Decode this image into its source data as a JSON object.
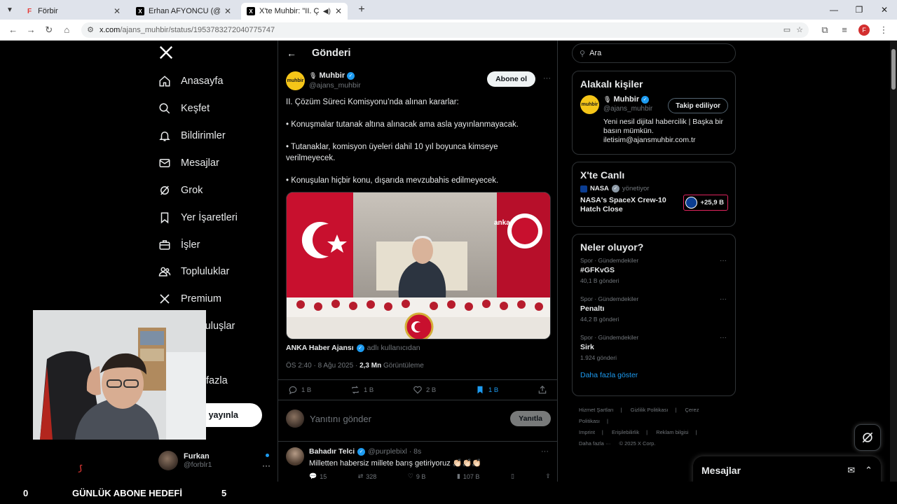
{
  "browser": {
    "tabs": [
      {
        "title": "Förbir",
        "favicon": "red-f-icon",
        "active": false
      },
      {
        "title": "Erhan AFYONCU (@eafyoncu) /",
        "favicon": "x-icon",
        "active": false
      },
      {
        "title": "X'te   Muhbir: \"II. Çözüm",
        "favicon": "x-icon",
        "active": true
      }
    ],
    "url_host": "x.com",
    "url_path": "/ajans_muhbir/status/1953783272040775747"
  },
  "nav": {
    "items": [
      {
        "label": "Anasayfa",
        "icon": "home-icon"
      },
      {
        "label": "Keşfet",
        "icon": "search-icon"
      },
      {
        "label": "Bildirimler",
        "icon": "bell-icon"
      },
      {
        "label": "Mesajlar",
        "icon": "mail-icon"
      },
      {
        "label": "Grok",
        "icon": "grok-icon"
      },
      {
        "label": "Yer İşaretleri",
        "icon": "bookmark-icon"
      },
      {
        "label": "İşler",
        "icon": "briefcase-icon"
      },
      {
        "label": "Topluluklar",
        "icon": "people-icon"
      },
      {
        "label": "Premium",
        "icon": "x-icon"
      },
      {
        "label": "n Kuruluşlar",
        "icon": "lightning-icon"
      },
      {
        "label": "",
        "icon": "person-icon"
      },
      {
        "label": "fazla",
        "icon": "more-icon"
      }
    ],
    "post_label": "i yayınla",
    "account": {
      "name": "Furkan",
      "handle": "@forblr1"
    }
  },
  "post": {
    "header_title": "Gönderi",
    "author_name": "Muhbir",
    "author_handle": "@ajans_muhbir",
    "avatar_text": "muhbir",
    "subscribe_label": "Abone ol",
    "text_lines": [
      "II. Çözüm Süreci Komisyonu’nda alınan kararlar:",
      "• Konuşmalar tutanak altına alınacak ama asla yayınlanmayacak.",
      "• Tutanaklar, komisyon üyeleri dahil 10 yıl boyunca kimseye verilmeyecek.",
      "• Konuşulan hiçbir konu, dışarıda mevzubahis edilmeyecek."
    ],
    "media_watermark": "anka",
    "media_source_name": "ANKA Haber Ajansı",
    "media_source_suffix": "adlı kullanıcıdan",
    "time": "ÖS 2:40 · 8 Ağu 2025 · ",
    "views_count": "2,3 Mn",
    "views_label": "Görüntüleme",
    "replies": "1 B",
    "reposts": "1 B",
    "likes": "2 B",
    "bookmarks": "1 B"
  },
  "reply_box": {
    "placeholder": "Yanıtını gönder",
    "button": "Yanıtla"
  },
  "reply": {
    "name": "Bahadır Telci",
    "handle": "@purplebixl · 8s",
    "text": "Milletten habersiz millete barış getiriyoruz 👏🏻👏🏻👏🏻",
    "replies": "15",
    "reposts": "328",
    "likes": "9 B",
    "views": "107 B"
  },
  "right": {
    "search_placeholder": "Ara",
    "related_title": "Alakalı kişiler",
    "related": {
      "name": "Muhbir",
      "handle": "@ajans_muhbir",
      "follow_label": "Takip ediliyor",
      "bio": "Yeni nesil dijital habercilik | Başka bir basın mümkün. iletisim@ajansmuhbir.com.tr"
    },
    "live_title": "X'te Canlı",
    "live": {
      "host": "NASA",
      "role": "yönetiyor",
      "title": "NASA's SpaceX Crew-10 Hatch Close",
      "count": "+25,9 B"
    },
    "trends_title": "Neler oluyor?",
    "trends": [
      {
        "category": "Spor · Gündemdekiler",
        "title": "#GFKvGS",
        "count": "40,1 B gönderi"
      },
      {
        "category": "Spor · Gündemdekiler",
        "title": "Penaltı",
        "count": "44,2 B gönderi"
      },
      {
        "category": "Spor · Gündemdekiler",
        "title": "Sirk",
        "count": "1.924 gönderi"
      }
    ],
    "show_more": "Daha fazla göster",
    "footer_links": [
      "Hizmet Şartları",
      "|",
      "Gizlilik Politikası",
      "|",
      "Çerez Politikası",
      "|",
      "Imprint",
      "|",
      "Erişilebilirlik",
      "|",
      "Reklam bilgisi",
      "|",
      "Daha fazla ···",
      "© 2025 X Corp."
    ]
  },
  "messages_drawer": {
    "title": "Mesajlar"
  },
  "stream": {
    "left_count": "0",
    "label": "GÜNLÜK ABONE HEDEFİ",
    "right_count": "5"
  }
}
